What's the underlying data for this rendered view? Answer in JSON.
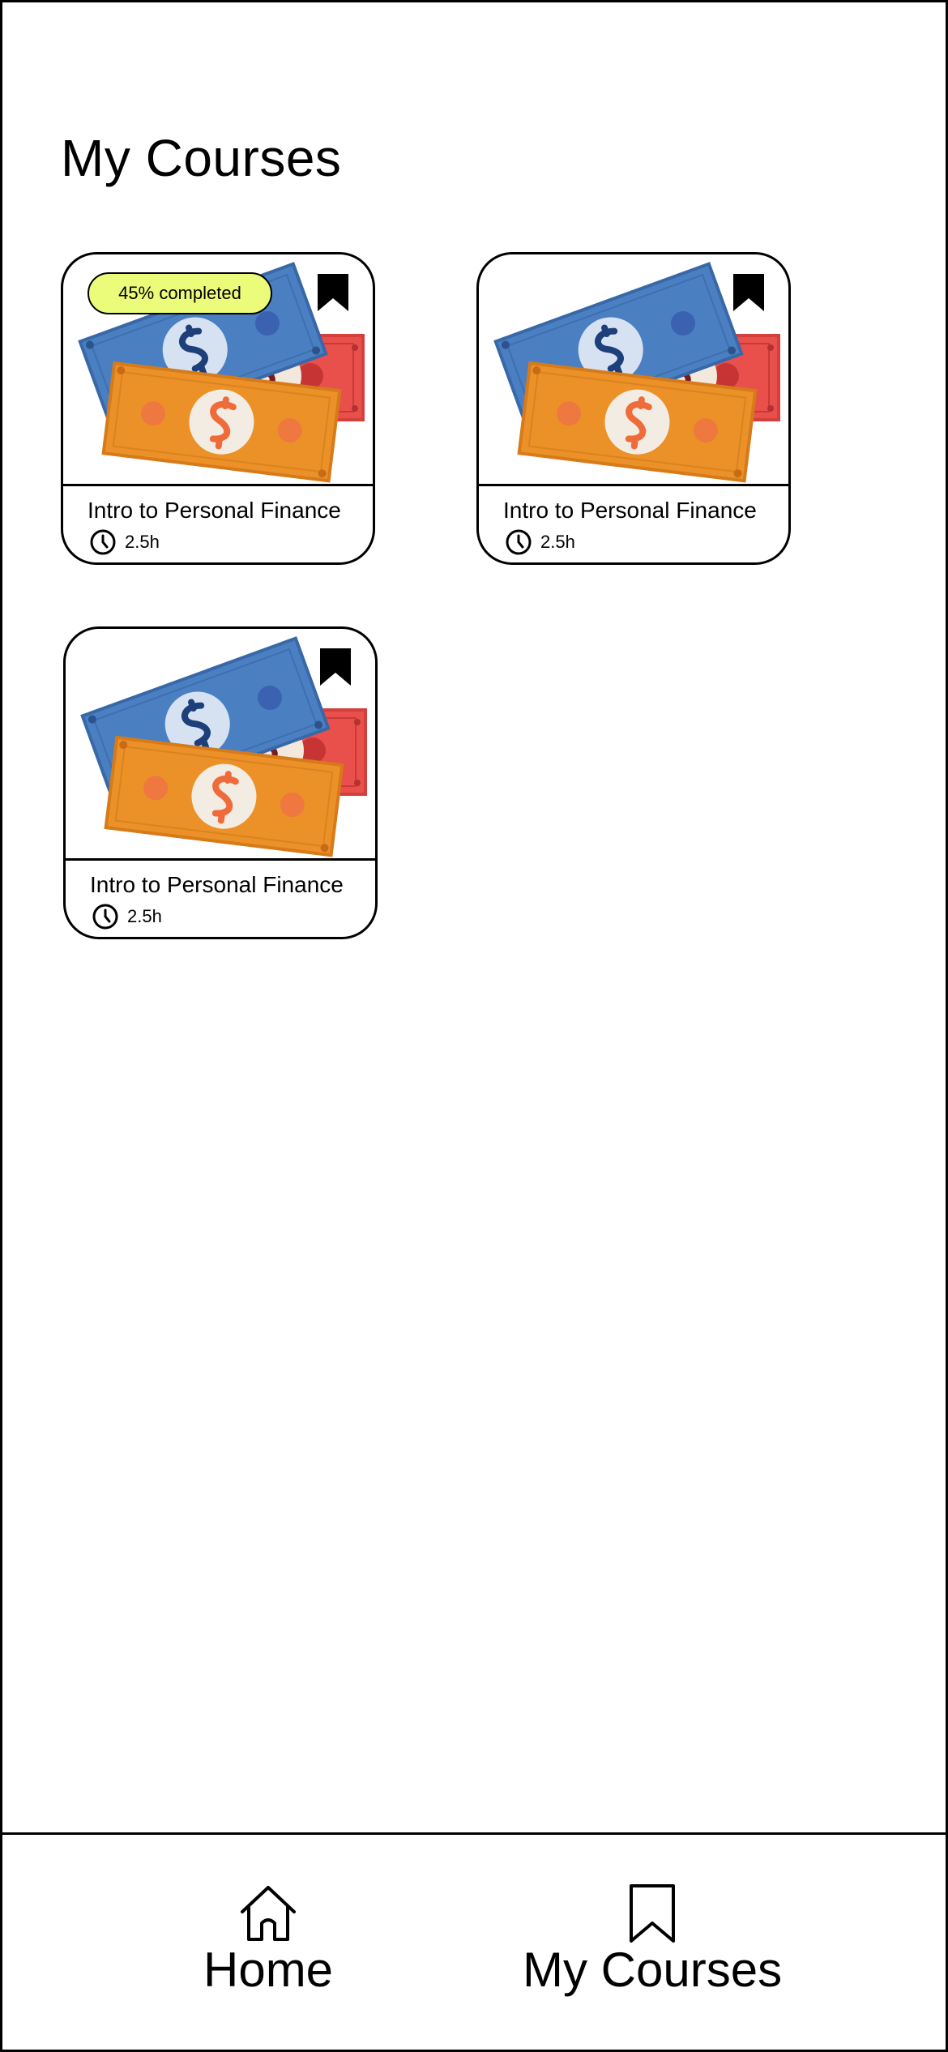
{
  "header": {
    "title": "My Courses"
  },
  "courses": [
    {
      "title": "Intro to Personal Finance",
      "duration": "2.5h",
      "progress_label": "45% completed",
      "progress": 0.45,
      "bookmarked": true
    },
    {
      "title": "Intro to Personal Finance",
      "duration": "2.5h",
      "bookmarked": true
    },
    {
      "title": "Intro to Personal Finance",
      "duration": "2.5h",
      "bookmarked": true
    }
  ],
  "nav": {
    "items": [
      {
        "label": "Home",
        "icon": "home-icon"
      },
      {
        "label": "My Courses",
        "icon": "bookmark-icon"
      }
    ]
  },
  "colors": {
    "badge": "#eafc7a",
    "bill_blue": "#4a7fc1",
    "bill_red": "#e9504c",
    "bill_orange": "#ec9127"
  }
}
